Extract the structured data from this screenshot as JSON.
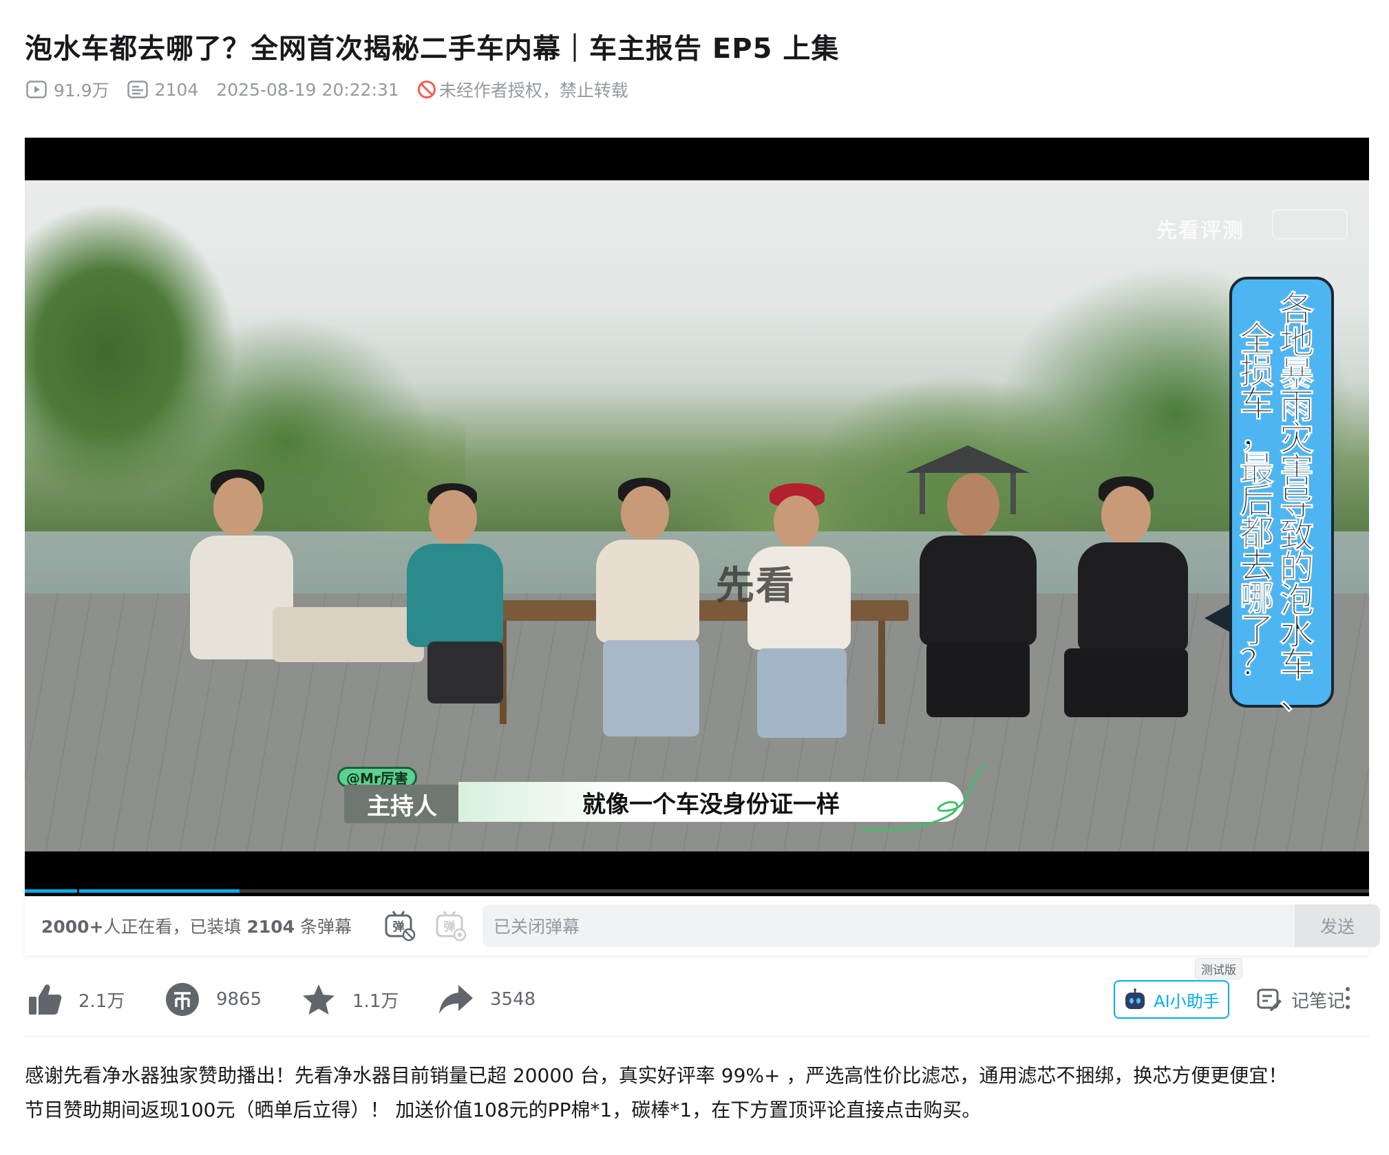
{
  "title": "泡水车都去哪了？全网首次揭秘二手车内幕｜车主报告 EP5 上集",
  "meta": {
    "views": "91.9万",
    "danmaku_count": "2104",
    "datetime": "2025-08-19 20:22:31",
    "copyright_notice": "未经作者授权，禁止转载"
  },
  "video": {
    "watermark": "先看评测",
    "bubble_lines": [
      "各地暴雨灾害导致的泡水车、",
      "全损车，最后都去哪了？"
    ],
    "host_tag": "@Mr厉害",
    "host_label": "主持人",
    "subtitle": "就像一个车没身份证一样",
    "sign_text": "先看",
    "progress_percent": 16
  },
  "danmaku_bar": {
    "viewers_prefix": "2000+",
    "viewers_middle": "人正在看，已装填 ",
    "loaded_count": "2104",
    "viewers_suffix": " 条弹幕",
    "input_placeholder": "已关闭弹幕",
    "send_label": "发送"
  },
  "actions": {
    "like": "2.1万",
    "coin": "9865",
    "favorite": "1.1万",
    "share": "3548",
    "ai_label": "AI小助手",
    "ai_badge": "测试版",
    "notes_label": "记笔记"
  },
  "description": [
    "感谢先看净水器独家赞助播出！先看净水器目前销量已超 20000 台，真实好评率 99%+ ，严选高性价比滤芯，通用滤芯不捆绑，换芯方便更便宜！",
    "节目赞助期间返现100元（晒单后立得）！ 加送价值108元的PP棉*1，碳棒*1，在下方置顶评论直接点击购买。"
  ],
  "colors": {
    "accent": "#00aeec",
    "bubble": "#4db6f2",
    "text_secondary": "#61666d",
    "warn_icon": "#f85a54"
  }
}
